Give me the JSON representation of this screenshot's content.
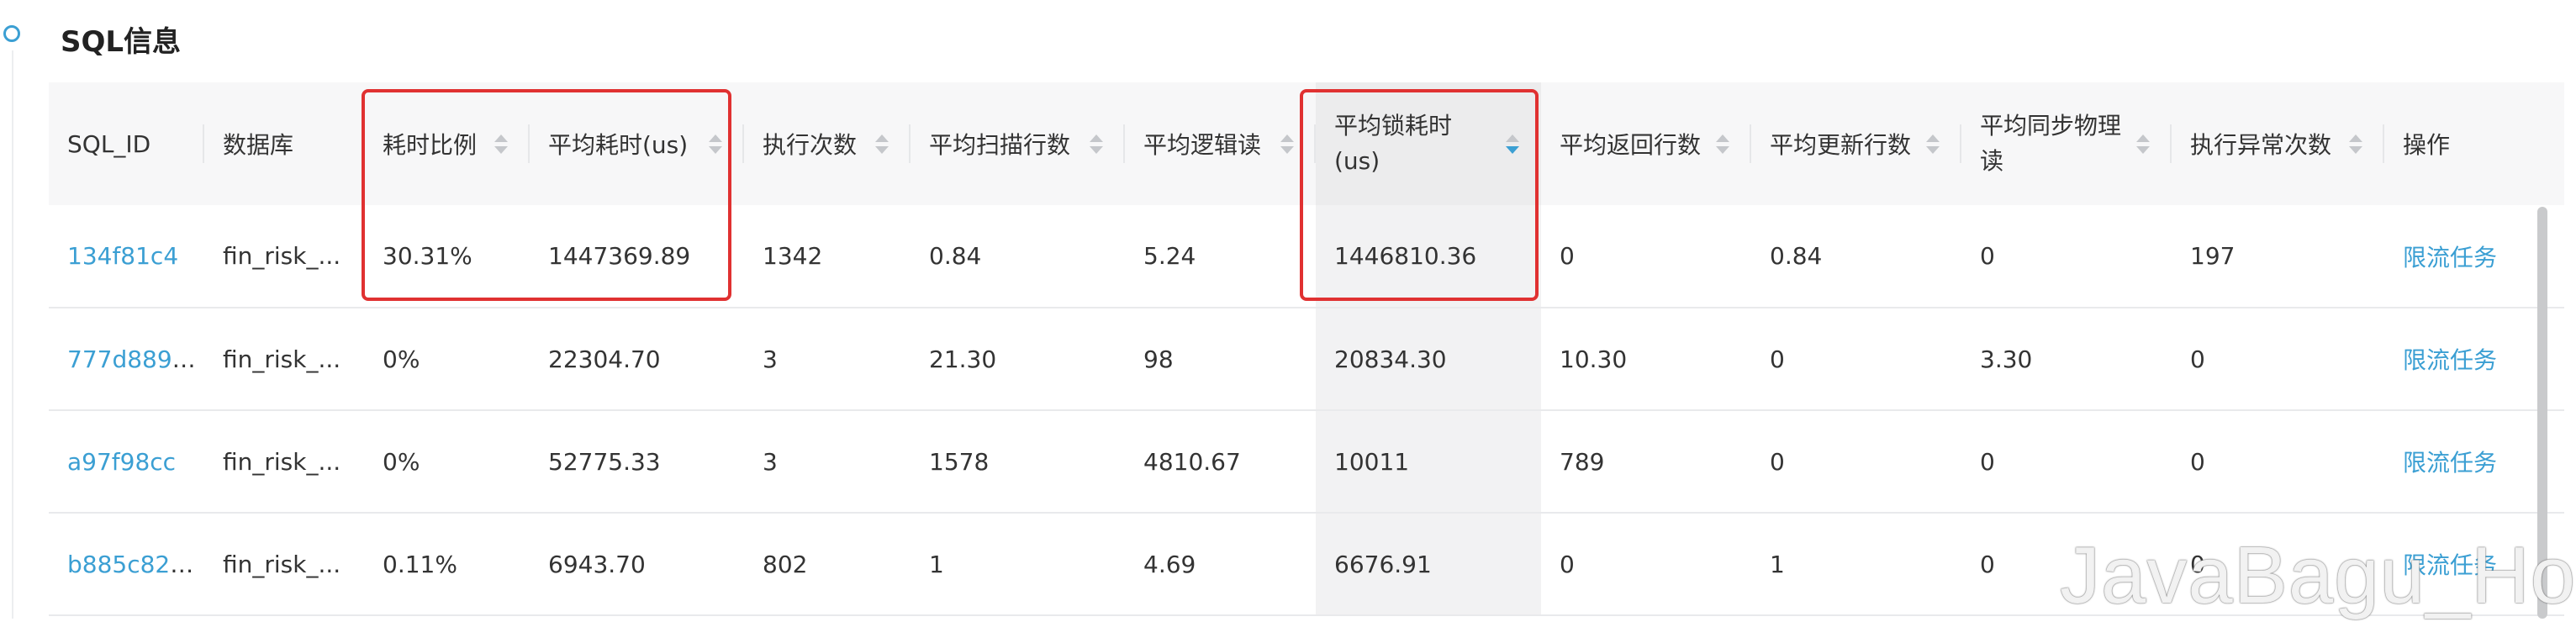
{
  "section": {
    "title": "SQL信息"
  },
  "table": {
    "columns": [
      {
        "key": "sql_id",
        "label": "SQL_ID",
        "sortable": false
      },
      {
        "key": "db",
        "label": "数据库",
        "sortable": false
      },
      {
        "key": "time_ratio",
        "label": "耗时比例",
        "sortable": true
      },
      {
        "key": "avg_time",
        "label": "平均耗时(us)",
        "sortable": true
      },
      {
        "key": "exec_count",
        "label": "执行次数",
        "sortable": true
      },
      {
        "key": "avg_scan_rows",
        "label": "平均扫描行数",
        "sortable": true
      },
      {
        "key": "avg_logical_reads",
        "label": "平均逻辑读",
        "sortable": true
      },
      {
        "key": "avg_lock_time",
        "label": "平均锁耗时(us)",
        "sortable": true,
        "sorted": "desc"
      },
      {
        "key": "avg_return_rows",
        "label": "平均返回行数",
        "sortable": true
      },
      {
        "key": "avg_update_rows",
        "label": "平均更新行数",
        "sortable": true
      },
      {
        "key": "avg_sync_physical_reads",
        "label": "平均同步物理读",
        "sortable": true
      },
      {
        "key": "exec_error_count",
        "label": "执行异常次数",
        "sortable": true
      },
      {
        "key": "actions",
        "label": "操作",
        "sortable": false
      }
    ],
    "rows": [
      {
        "sql_id": "134f81c4",
        "db": "fin_risk_...",
        "time_ratio": "30.31%",
        "avg_time": "1447369.89",
        "exec_count": "1342",
        "avg_scan_rows": "0.84",
        "avg_logical_reads": "5.24",
        "avg_lock_time": "1446810.36",
        "avg_return_rows": "0",
        "avg_update_rows": "0.84",
        "avg_sync_physical_reads": "0",
        "exec_error_count": "197",
        "action": "限流任务"
      },
      {
        "sql_id": "777d889b...",
        "db": "fin_risk_...",
        "time_ratio": "0%",
        "avg_time": "22304.70",
        "exec_count": "3",
        "avg_scan_rows": "21.30",
        "avg_logical_reads": "98",
        "avg_lock_time": "20834.30",
        "avg_return_rows": "10.30",
        "avg_update_rows": "0",
        "avg_sync_physical_reads": "3.30",
        "exec_error_count": "0",
        "action": "限流任务"
      },
      {
        "sql_id": "a97f98cc",
        "db": "fin_risk_...",
        "time_ratio": "0%",
        "avg_time": "52775.33",
        "exec_count": "3",
        "avg_scan_rows": "1578",
        "avg_logical_reads": "4810.67",
        "avg_lock_time": "10011",
        "avg_return_rows": "789",
        "avg_update_rows": "0",
        "avg_sync_physical_reads": "0",
        "exec_error_count": "0",
        "action": "限流任务"
      },
      {
        "sql_id": "b885c825...",
        "db": "fin_risk_...",
        "time_ratio": "0.11%",
        "avg_time": "6943.70",
        "exec_count": "802",
        "avg_scan_rows": "1",
        "avg_logical_reads": "4.69",
        "avg_lock_time": "6676.91",
        "avg_return_rows": "0",
        "avg_update_rows": "1",
        "avg_sync_physical_reads": "0",
        "exec_error_count": "0",
        "action": "限流任务"
      }
    ]
  },
  "watermark": "JavaBagu_Hollis",
  "colors": {
    "link": "#3b9fd3",
    "highlight_box": "#e03131"
  }
}
